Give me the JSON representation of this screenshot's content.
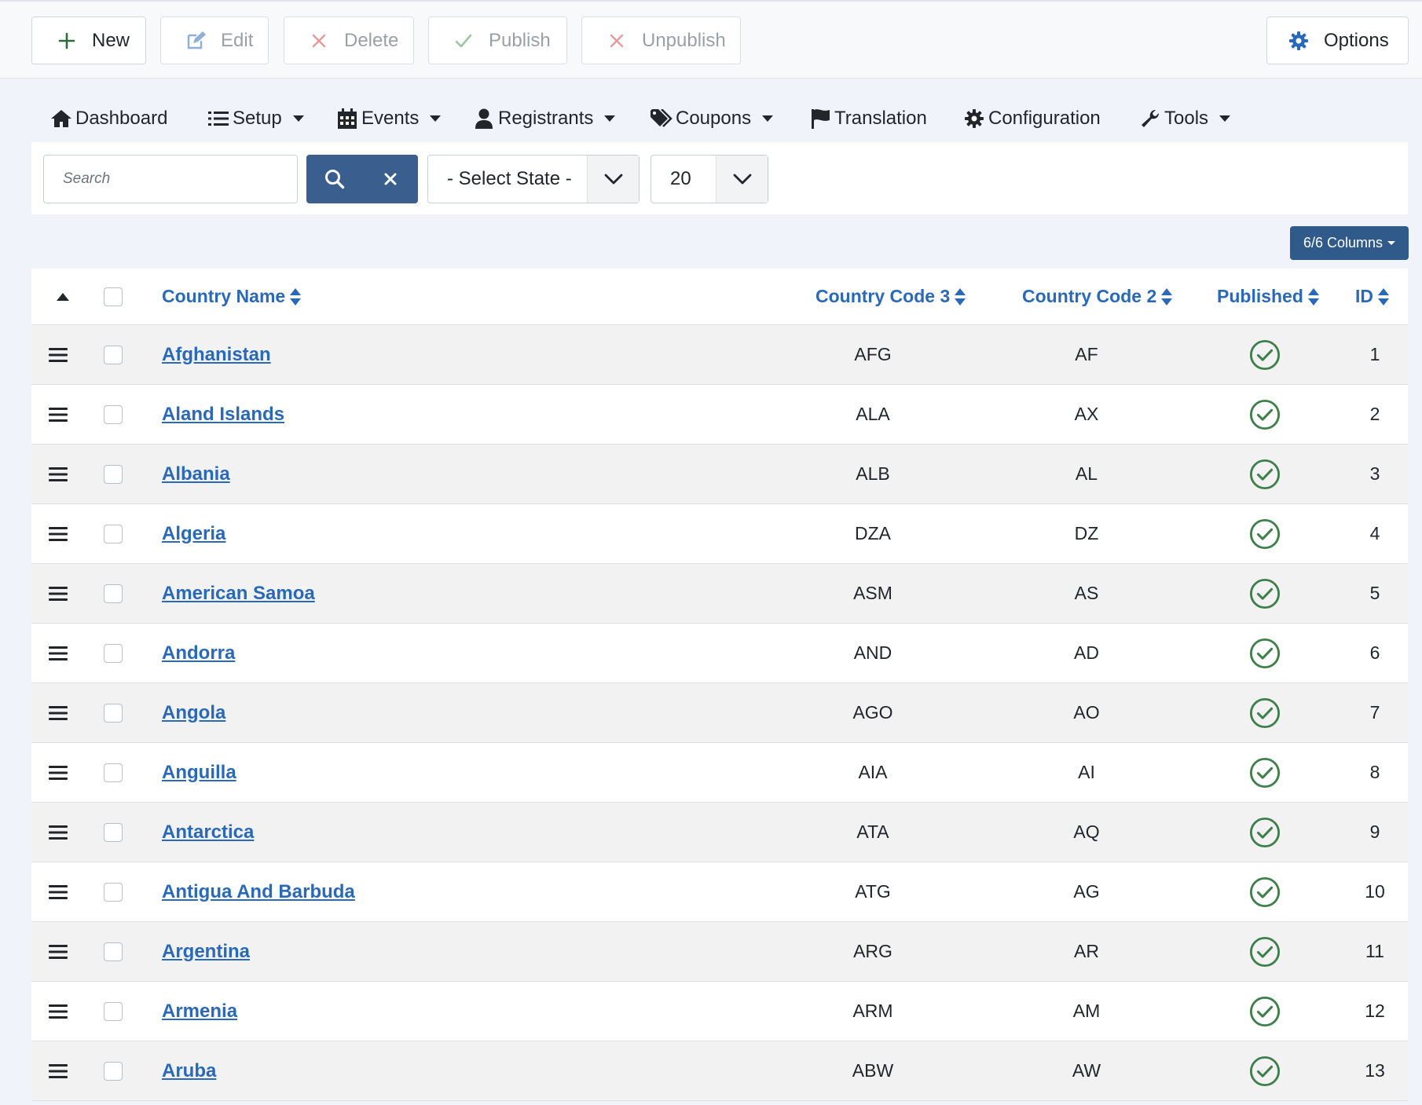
{
  "toolbar": {
    "new_label": "New",
    "edit_label": "Edit",
    "delete_label": "Delete",
    "publish_label": "Publish",
    "unpublish_label": "Unpublish",
    "options_label": "Options"
  },
  "nav": {
    "dashboard": "Dashboard",
    "setup": "Setup",
    "events": "Events",
    "registrants": "Registrants",
    "coupons": "Coupons",
    "translation": "Translation",
    "configuration": "Configuration",
    "tools": "Tools"
  },
  "filters": {
    "search_placeholder": "Search",
    "state_selected": "- Select State -",
    "limit_selected": "20"
  },
  "columns_button": "6/6 Columns",
  "table": {
    "headers": {
      "country_name": "Country Name",
      "code3": "Country Code 3",
      "code2": "Country Code 2",
      "published": "Published",
      "id": "ID"
    },
    "rows": [
      {
        "name": "Afghanistan",
        "code3": "AFG",
        "code2": "AF",
        "id": "1"
      },
      {
        "name": "Aland Islands",
        "code3": "ALA",
        "code2": "AX",
        "id": "2"
      },
      {
        "name": "Albania",
        "code3": "ALB",
        "code2": "AL",
        "id": "3"
      },
      {
        "name": "Algeria",
        "code3": "DZA",
        "code2": "DZ",
        "id": "4"
      },
      {
        "name": "American Samoa",
        "code3": "ASM",
        "code2": "AS",
        "id": "5"
      },
      {
        "name": "Andorra",
        "code3": "AND",
        "code2": "AD",
        "id": "6"
      },
      {
        "name": "Angola",
        "code3": "AGO",
        "code2": "AO",
        "id": "7"
      },
      {
        "name": "Anguilla",
        "code3": "AIA",
        "code2": "AI",
        "id": "8"
      },
      {
        "name": "Antarctica",
        "code3": "ATA",
        "code2": "AQ",
        "id": "9"
      },
      {
        "name": "Antigua And Barbuda",
        "code3": "ATG",
        "code2": "AG",
        "id": "10"
      },
      {
        "name": "Argentina",
        "code3": "ARG",
        "code2": "AR",
        "id": "11"
      },
      {
        "name": "Armenia",
        "code3": "ARM",
        "code2": "AM",
        "id": "12"
      },
      {
        "name": "Aruba",
        "code3": "ABW",
        "code2": "AW",
        "id": "13"
      }
    ]
  },
  "colors": {
    "link": "#2a69b8",
    "published_green": "#3e7f4a",
    "primary_button": "#3a5f8f"
  }
}
